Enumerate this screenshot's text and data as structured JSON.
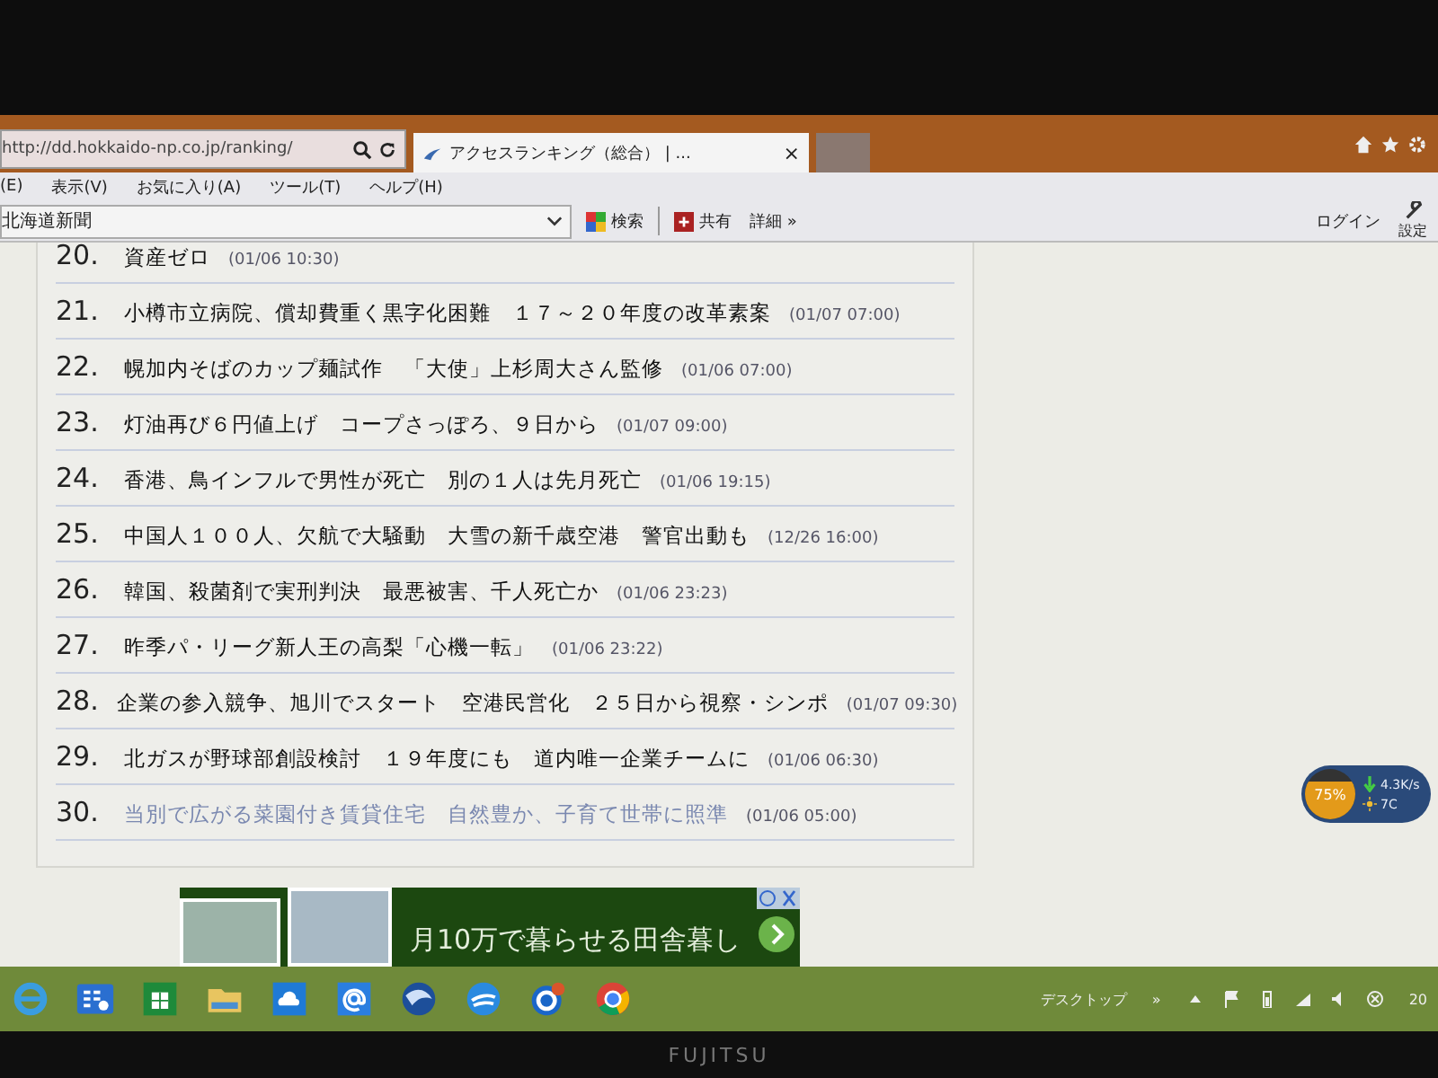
{
  "browser": {
    "address": {
      "value": "http://dd.hokkaido-np.co.jp/ranking/"
    },
    "tab": {
      "title": "アクセスランキング（総合） | ...",
      "close": "×",
      "selected": true
    },
    "menu": [
      "(E)",
      "表示(V)",
      "お気に入り(A)",
      "ツール(T)",
      "ヘルプ(H)"
    ],
    "toolbar": {
      "favorite_field": {
        "value": "北海道新聞"
      },
      "search": "検索",
      "share": "共有",
      "more": "詳細 »",
      "login": "ログイン",
      "settings": "設定"
    }
  },
  "ranking": [
    {
      "rank": "20.",
      "title": "資産ゼロ",
      "time": "(01/06 10:30)",
      "visited": false
    },
    {
      "rank": "21.",
      "title": "小樽市立病院、償却費重く黒字化困難　１７～２０年度の改革素案",
      "time": "(01/07 07:00)",
      "visited": false
    },
    {
      "rank": "22.",
      "title": "幌加内そばのカップ麺試作　「大使」上杉周大さん監修",
      "time": "(01/06 07:00)",
      "visited": false
    },
    {
      "rank": "23.",
      "title": "灯油再び６円値上げ　コープさっぽろ、９日から",
      "time": "(01/07 09:00)",
      "visited": false
    },
    {
      "rank": "24.",
      "title": "香港、鳥インフルで男性が死亡　別の１人は先月死亡",
      "time": "(01/06 19:15)",
      "visited": false
    },
    {
      "rank": "25.",
      "title": "中国人１００人、欠航で大騒動　大雪の新千歳空港　警官出動も",
      "time": "(12/26 16:00)",
      "visited": false
    },
    {
      "rank": "26.",
      "title": "韓国、殺菌剤で実刑判決　最悪被害、千人死亡か",
      "time": "(01/06 23:23)",
      "visited": false
    },
    {
      "rank": "27.",
      "title": "昨季パ・リーグ新人王の高梨「心機一転」",
      "time": "(01/06 23:22)",
      "visited": false
    },
    {
      "rank": "28.",
      "title": "企業の参入競争、旭川でスタート　空港民営化　２５日から視察・シンポ",
      "time": "(01/07 09:30)",
      "visited": false
    },
    {
      "rank": "29.",
      "title": "北ガスが野球部創設検討　１９年度にも　道内唯一企業チームに",
      "time": "(01/06 06:30)",
      "visited": false
    },
    {
      "rank": "30.",
      "title": "当別で広がる菜園付き賃貸住宅　自然豊か、子育て世帯に照準",
      "time": "(01/06 05:00)",
      "visited": true
    }
  ],
  "ad": {
    "text": "月10万で暮らせる田舎暮し"
  },
  "gadget": {
    "battery": "75%",
    "speed": "4.3K/s",
    "temperature": "7C"
  },
  "taskbar": {
    "toolbar_label": "デスクトップ",
    "overflow": "»",
    "clock": "20"
  },
  "bezel": {
    "logo": "FUJITSU"
  }
}
